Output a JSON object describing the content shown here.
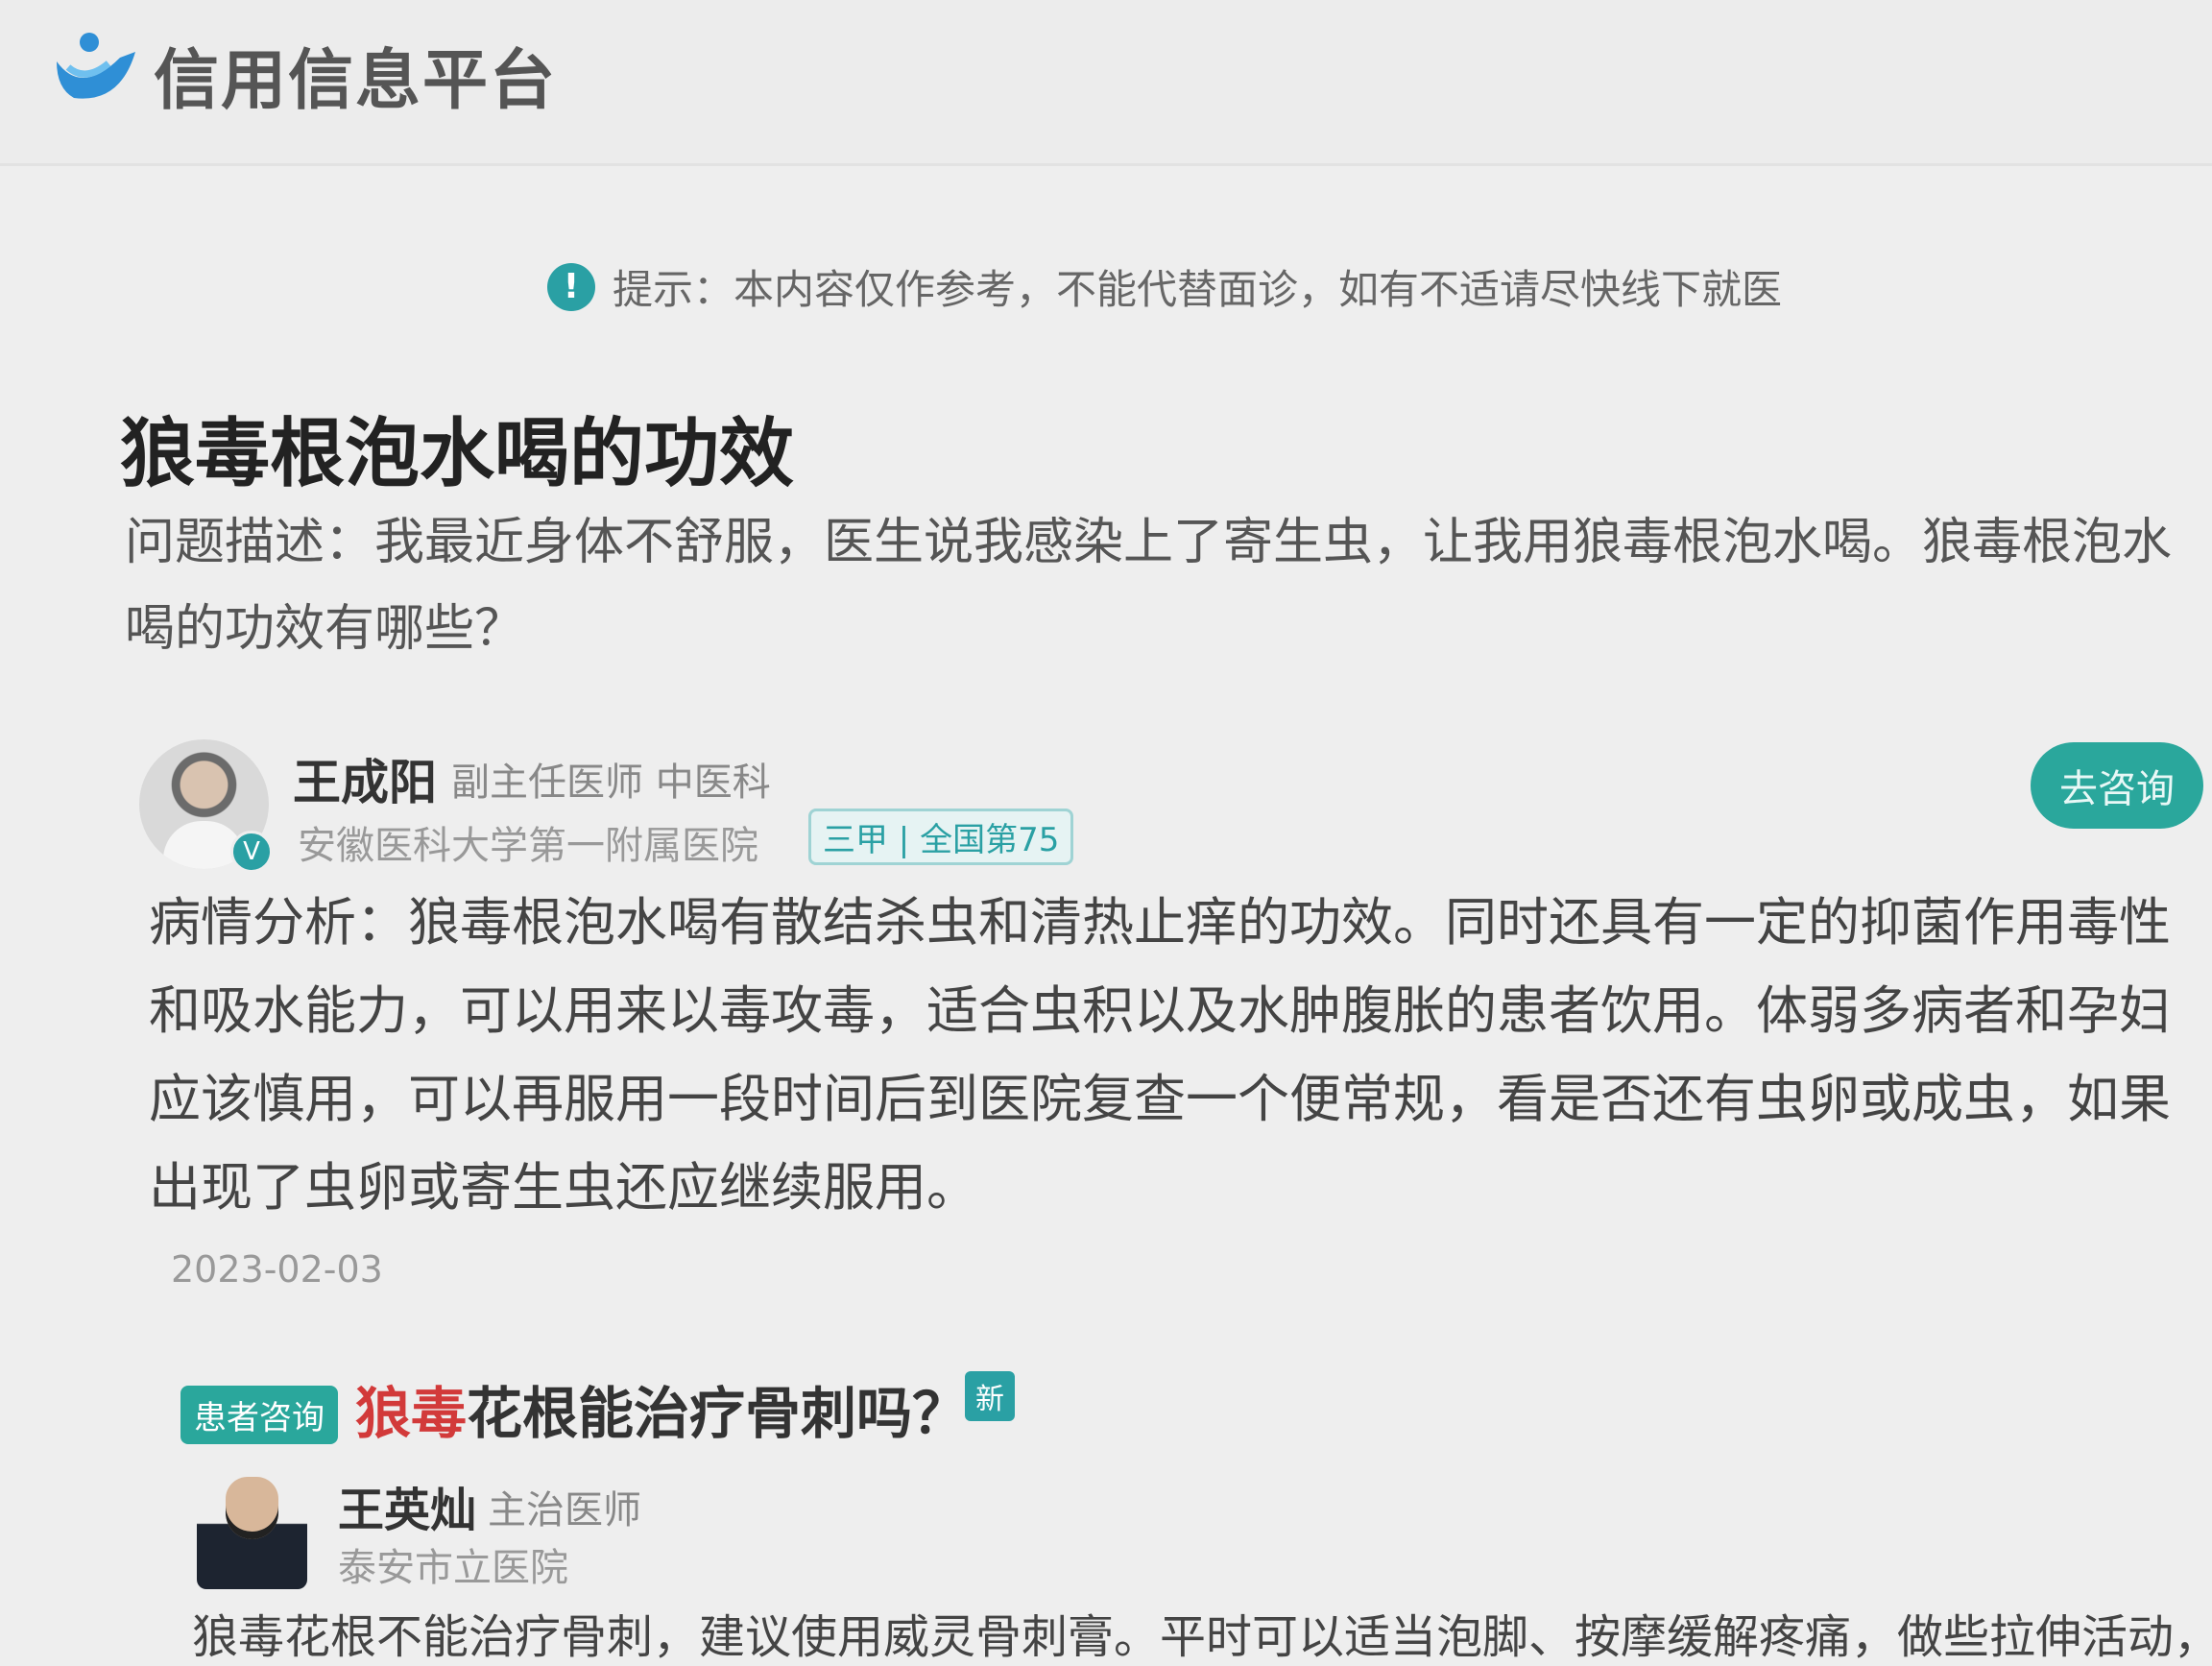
{
  "header": {
    "brand": "信用信息平台",
    "logo_icon": "platform-logo-icon"
  },
  "notice": {
    "icon": "exclamation-icon",
    "icon_glyph": "!",
    "text": "提示：本内容仅作参考，不能代替面诊，如有不适请尽快线下就医"
  },
  "question": {
    "title": "狼毒根泡水喝的功效",
    "description": "问题描述：我最近身体不舒服，医生说我感染上了寄生虫，让我用狼毒根泡水喝。狼毒根泡水喝的功效有哪些？"
  },
  "doctor": {
    "name": "王成阳",
    "title": "副主任医师  中医科",
    "hospital": "安徽医科大学第一附属医院",
    "hospital_tag": "三甲 | 全国第75",
    "verified_glyph": "V",
    "consult_button": "去咨询"
  },
  "answer": {
    "text": "病情分析：狼毒根泡水喝有散结杀虫和清热止痒的功效。同时还具有一定的抑菌作用毒性和吸水能力，可以用来以毒攻毒，适合虫积以及水肿腹胀的患者饮用。体弱多病者和孕妇应该慎用，可以再服用一段时间后到医院复查一个便常规，看是否还有虫卵或成虫，如果出现了虫卵或寄生虫还应继续服用。",
    "date": "2023-02-03"
  },
  "related": {
    "tag": "患者咨询",
    "title_highlight": "狼毒",
    "title_rest": "花根能治疗骨刺吗？",
    "new_badge": "新",
    "doctor_name": "王英灿",
    "doctor_title": "主治医师",
    "doctor_hospital": "泰安市立医院",
    "answer_preview": "狼毒花根不能治疗骨刺，建议使用威灵骨刺膏。平时可以适当泡脚、按摩缓解疼痛，做些拉伸活动，"
  },
  "colors": {
    "accent": "#2aa79c",
    "highlight": "#d23a3a",
    "background": "#eeeeee"
  }
}
